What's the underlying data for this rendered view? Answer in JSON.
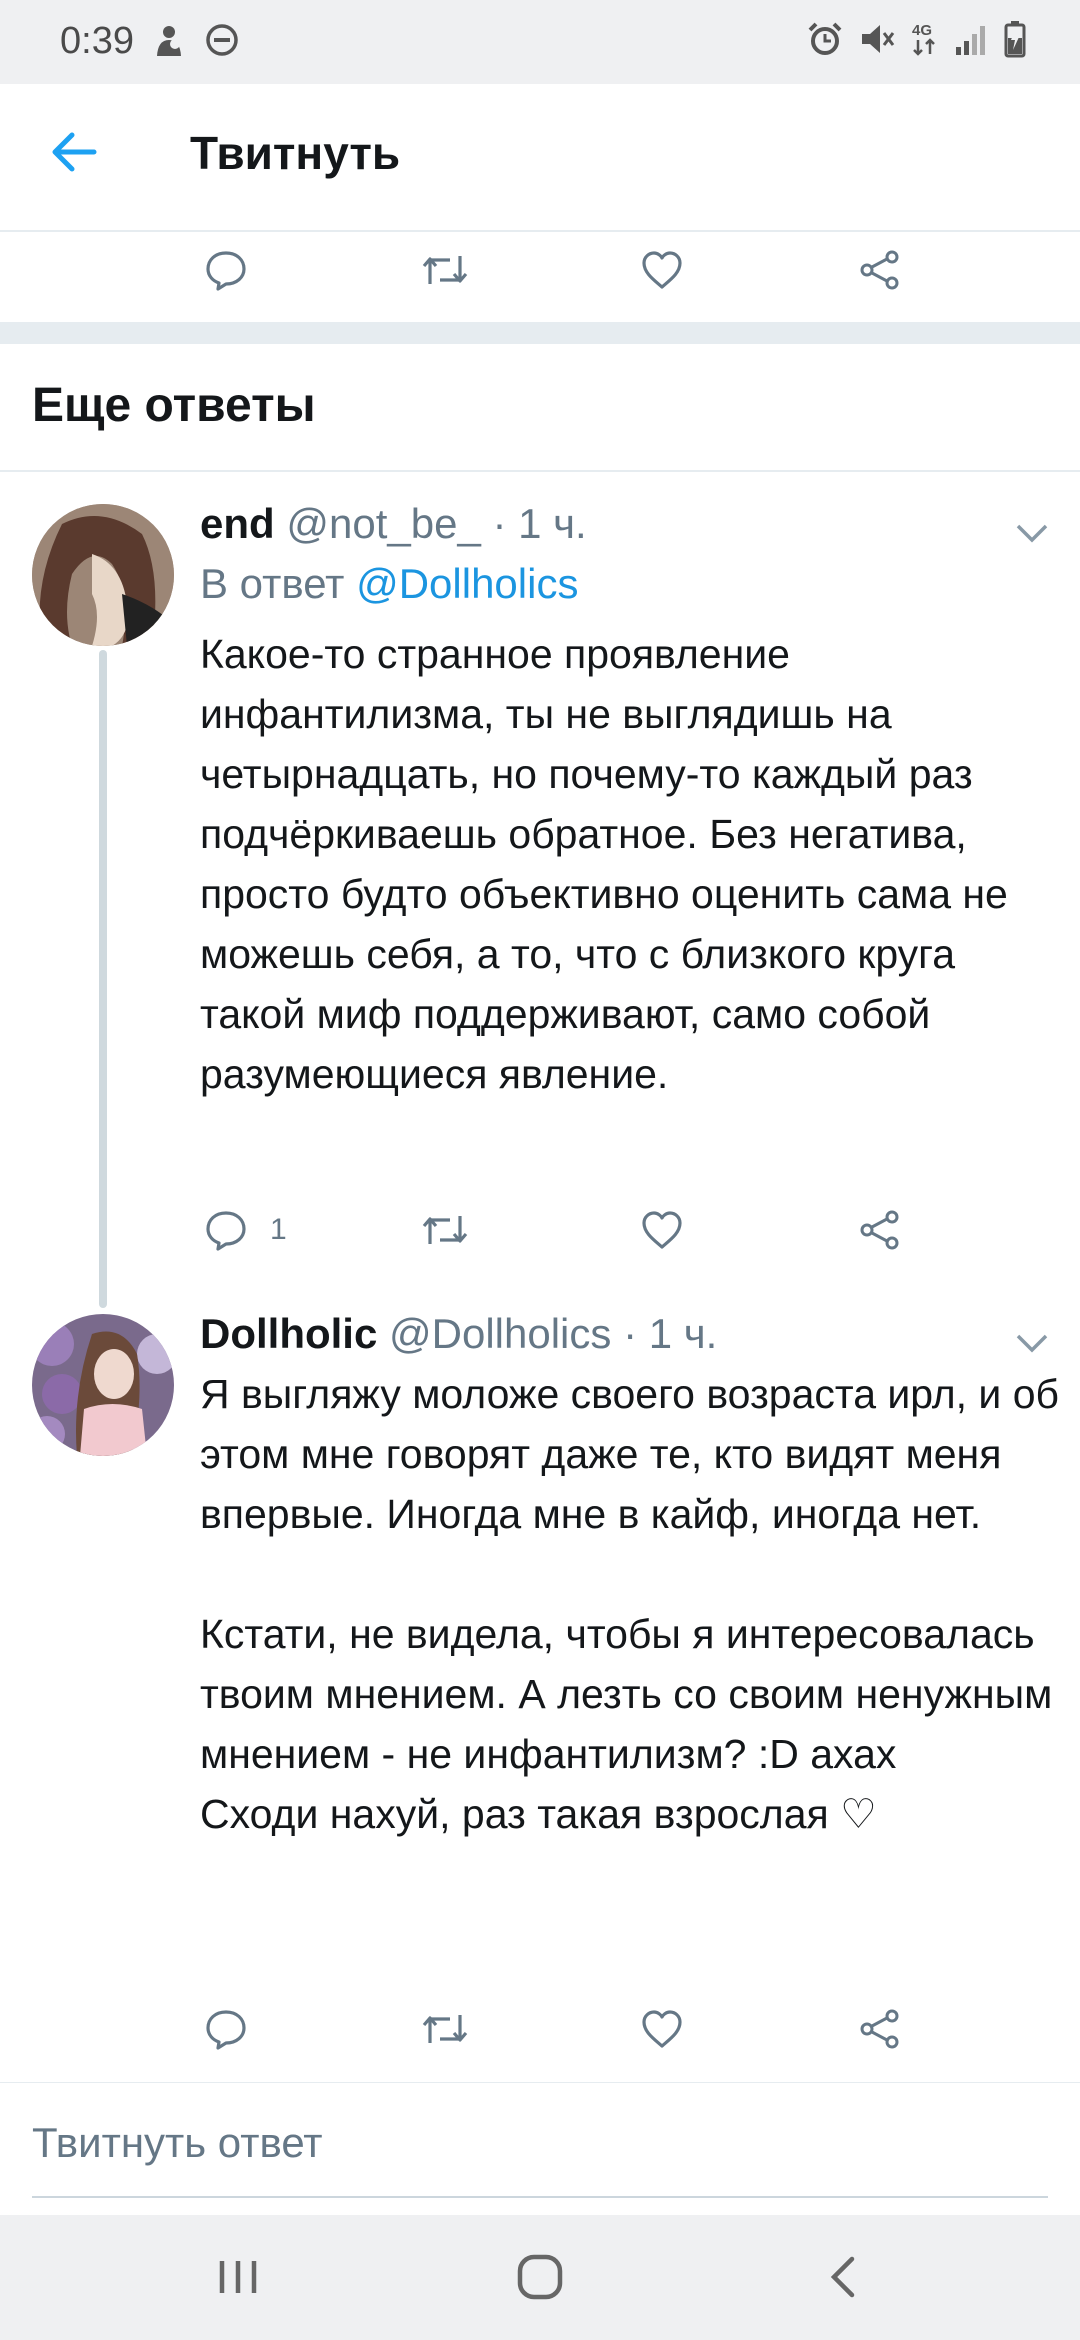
{
  "status_bar": {
    "time": "0:39",
    "network": "4G",
    "left_icons": [
      "notification-icon",
      "do-not-disturb-icon"
    ],
    "right_icons": [
      "alarm-icon",
      "mute-icon",
      "network-4g-icon",
      "signal-icon",
      "battery-charging-icon"
    ]
  },
  "header": {
    "title": "Твитнуть",
    "back_icon": "back-arrow-icon"
  },
  "main_actions": {
    "icons": [
      "reply-icon",
      "retweet-icon",
      "like-icon",
      "share-icon"
    ]
  },
  "section": {
    "title": "Еще ответы"
  },
  "tweets": [
    {
      "name": "end",
      "handle": "@not_be_",
      "time": "· 1 ч.",
      "reply_prefix": "В ответ",
      "reply_to": "@Dollholics",
      "text": "Какое-то странное проявление инфантилизма, ты не выглядишь на четырнадцать, но почему-то каждый раз подчёркиваешь обратное. Без негатива, просто будто объективно оценить сама не можешь себя, а то, что с близкого круга такой миф поддерживают, само собой разумеющиеся явление.",
      "reply_count": "1"
    },
    {
      "name": "Dollholic",
      "handle": "@Dollholics",
      "time": "· 1 ч.",
      "text": "Я выгляжу моложе своего возраста ирл, и об этом мне говорят даже те, кто видят меня впервые. Иногда мне в кайф, иногда нет.\n\nКстати, не видела, чтобы я интересовалась твоим мнением. А лезть со своим ненужным мнением - не инфантилизм? :D ахах\nСходи нахуй, раз такая взрослая ♡"
    }
  ],
  "composer": {
    "placeholder": "Твитнуть ответ"
  },
  "nav": {
    "icons": [
      "recent-apps-icon",
      "home-icon",
      "back-icon"
    ]
  },
  "colors": {
    "accent": "#1da1f2",
    "mention": "#1b95e0",
    "secondary_text": "#657786",
    "icon": "#657786"
  }
}
